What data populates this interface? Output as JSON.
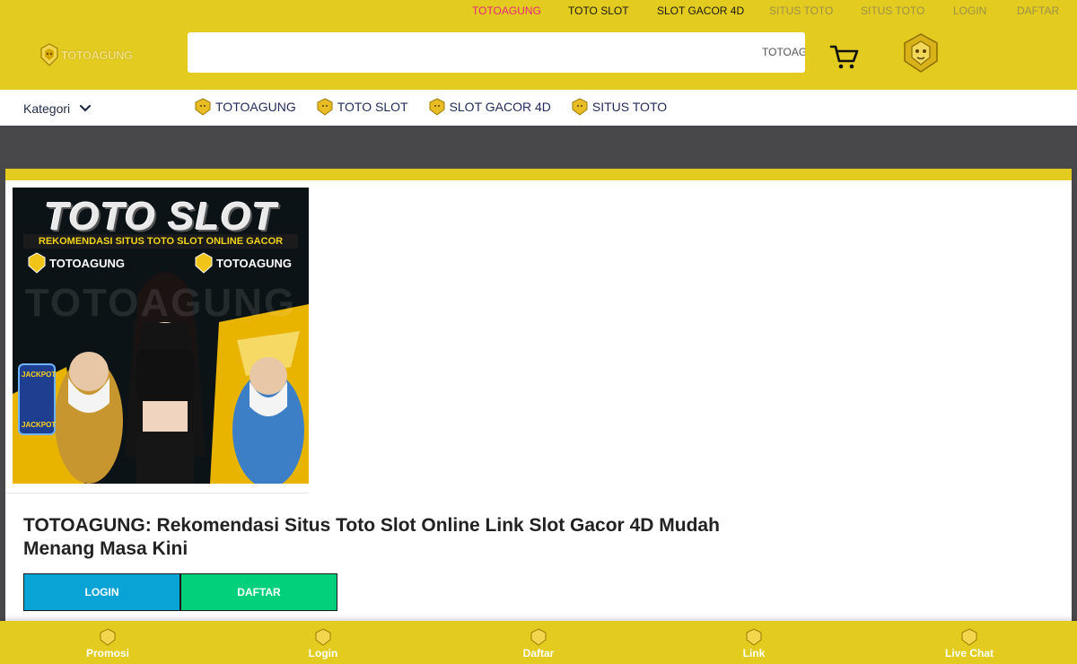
{
  "top_links": [
    {
      "label": "TOTOAGUNG",
      "color": "#e8257f"
    },
    {
      "label": "TOTO SLOT",
      "color": "#1a1a1a"
    },
    {
      "label": "SLOT GACOR 4D",
      "color": "#1a1a1a"
    },
    {
      "label": "SITUS TOTO",
      "color": "#9b8f4a"
    },
    {
      "label": "SITUS TOTO",
      "color": "#9b8f4a"
    },
    {
      "label": "LOGIN",
      "color": "#9b8f4a"
    },
    {
      "label": "DAFTAR",
      "color": "#9b8f4a"
    }
  ],
  "logo": {
    "text": "TOTOAGUNG"
  },
  "search": {
    "value": "",
    "term": "TOTOAGUNG"
  },
  "category": {
    "label": "Kategori",
    "links": [
      "TOTOAGUNG",
      "TOTO SLOT",
      "SLOT GACOR 4D",
      "SITUS TOTO"
    ]
  },
  "banner": {
    "title": "TOTO SLOT",
    "subtitle": "REKOMENDASI SITUS TOTO SLOT ONLINE GACOR",
    "brand": "TOTOAGUNG",
    "watermark": "TOTOAGUNG",
    "jackpot": "JACKPOT"
  },
  "headline": "TOTOAGUNG: Rekomendasi Situs Toto Slot Online Link Slot Gacor 4D Mudah Menang Masa Kini",
  "buttons": {
    "login": "LOGIN",
    "daftar": "DAFTAR"
  },
  "bottom_nav": [
    "Promosi",
    "Login",
    "Daftar",
    "Link",
    "Live Chat"
  ],
  "colors": {
    "brand_yellow": "#e3cc1f",
    "login_blue": "#0aa3d6",
    "daftar_green": "#03d07a",
    "dark_band": "#48474a"
  }
}
